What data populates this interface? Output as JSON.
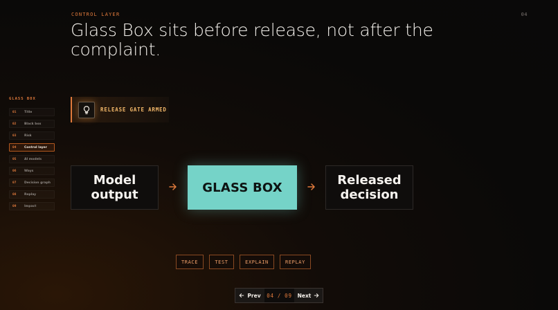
{
  "header": {
    "eyebrow": "CONTROL LAYER",
    "page_number": "04",
    "headline": "Glass Box sits before release, not after the complaint."
  },
  "sidebar": {
    "title": "GLASS BOX",
    "items": [
      {
        "num": "01",
        "label": "Title"
      },
      {
        "num": "02",
        "label": "Black box"
      },
      {
        "num": "03",
        "label": "Risk"
      },
      {
        "num": "04",
        "label": "Control layer",
        "active": true
      },
      {
        "num": "05",
        "label": "AI models"
      },
      {
        "num": "06",
        "label": "Ways"
      },
      {
        "num": "07",
        "label": "Decision graph"
      },
      {
        "num": "08",
        "label": "Replay"
      },
      {
        "num": "09",
        "label": "Impact"
      }
    ]
  },
  "status": {
    "icon": "lightbulb-icon",
    "label": "RELEASE GATE ARMED"
  },
  "flow": {
    "input": "Model output",
    "gate": "GLASS BOX",
    "output": "Released decision"
  },
  "actions": [
    "TRACE",
    "TEST",
    "EXPLAIN",
    "REPLAY"
  ],
  "pager": {
    "prev_label": "Prev",
    "next_label": "Next",
    "current": "04",
    "total": "09",
    "separator": "/"
  },
  "colors": {
    "accent": "#e07a3c",
    "glass": "#75d3c8",
    "status_text": "#f4b96a"
  }
}
